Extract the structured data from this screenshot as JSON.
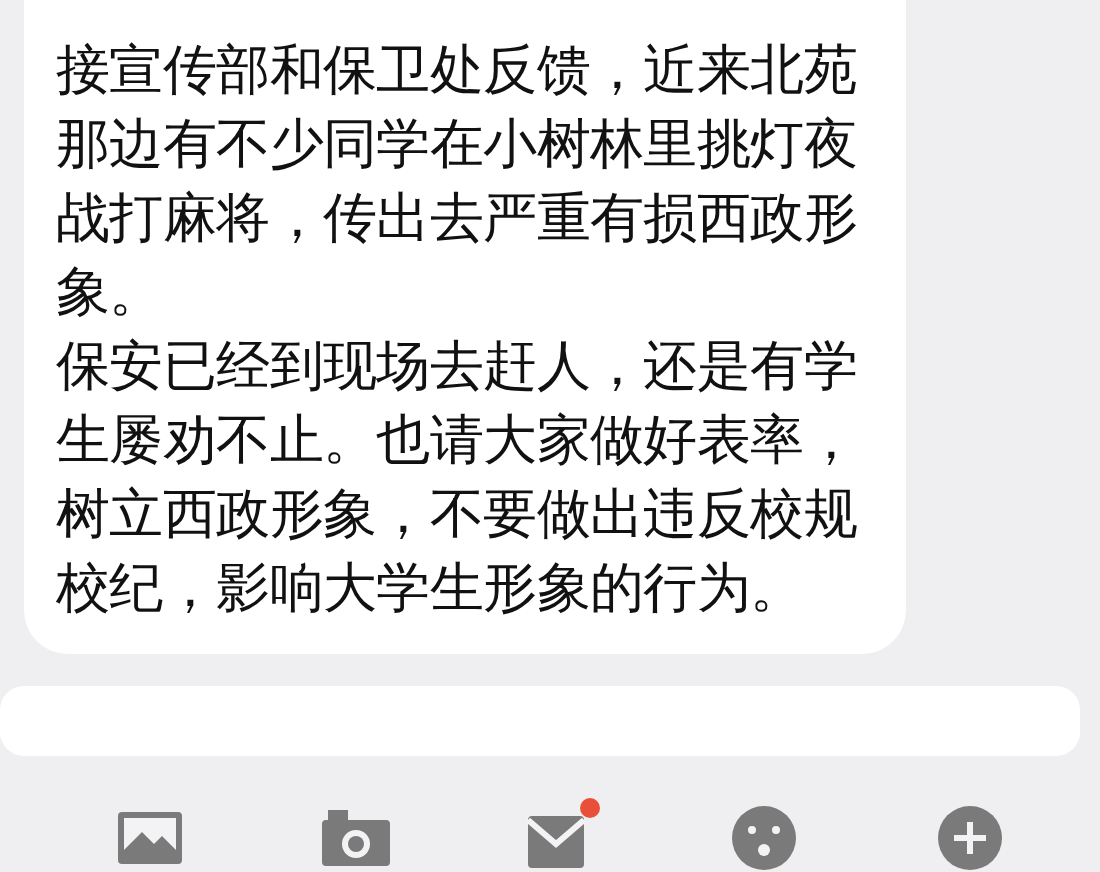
{
  "message": {
    "paragraphs": [
      "接宣传部和保卫处反馈，近来北苑那边有不少同学在小树林里挑灯夜战打麻将，传出去严重有损西政形象。",
      "保安已经到现场去赶人，还是有学生屡劝不止。也请大家做好表率，树立西政形象，不要做出违反校规校纪，影响大学生形象的行为。"
    ]
  },
  "toolbar": [
    {
      "kind": "picture",
      "badge": false
    },
    {
      "kind": "camera",
      "badge": false
    },
    {
      "kind": "envelope",
      "badge": true
    },
    {
      "kind": "emoji",
      "badge": false
    },
    {
      "kind": "plus",
      "badge": false
    }
  ]
}
